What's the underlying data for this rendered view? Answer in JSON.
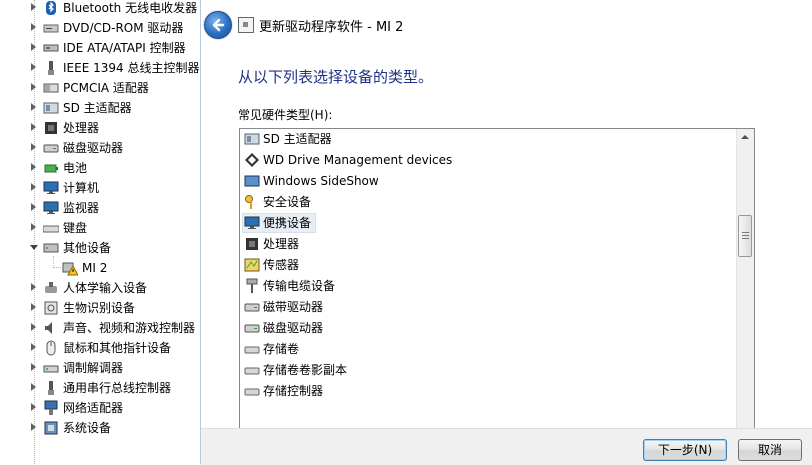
{
  "device_tree": {
    "items": [
      {
        "label": "Bluetooth 无线电收发器",
        "icon": "bluetooth-icon",
        "expanded": false
      },
      {
        "label": "DVD/CD-ROM 驱动器",
        "icon": "dvd-drive-icon",
        "expanded": false
      },
      {
        "label": "IDE ATA/ATAPI 控制器",
        "icon": "ide-controller-icon",
        "expanded": false
      },
      {
        "label": "IEEE 1394 总线主控制器",
        "icon": "ieee1394-icon",
        "expanded": false
      },
      {
        "label": "PCMCIA 适配器",
        "icon": "pcmcia-icon",
        "expanded": false
      },
      {
        "label": "SD 主适配器",
        "icon": "sd-adapter-icon",
        "expanded": false
      },
      {
        "label": "处理器",
        "icon": "processor-icon",
        "expanded": false
      },
      {
        "label": "磁盘驱动器",
        "icon": "disk-drive-icon",
        "expanded": false
      },
      {
        "label": "电池",
        "icon": "battery-icon",
        "expanded": false
      },
      {
        "label": "计算机",
        "icon": "computer-icon",
        "expanded": false
      },
      {
        "label": "监视器",
        "icon": "monitor-icon",
        "expanded": false
      },
      {
        "label": "键盘",
        "icon": "keyboard-icon",
        "expanded": false
      },
      {
        "label": "其他设备",
        "icon": "other-devices-icon",
        "expanded": true
      },
      {
        "label": "MI 2",
        "icon": "warning-device-icon",
        "child": true
      },
      {
        "label": "人体学输入设备",
        "icon": "hid-icon",
        "expanded": false
      },
      {
        "label": "生物识别设备",
        "icon": "biometric-icon",
        "expanded": false
      },
      {
        "label": "声音、视频和游戏控制器",
        "icon": "sound-icon",
        "expanded": false
      },
      {
        "label": "鼠标和其他指针设备",
        "icon": "mouse-icon",
        "expanded": false
      },
      {
        "label": "调制解调器",
        "icon": "modem-icon",
        "expanded": false
      },
      {
        "label": "通用串行总线控制器",
        "icon": "usb-icon",
        "expanded": false
      },
      {
        "label": "网络适配器",
        "icon": "network-adapter-icon",
        "expanded": false
      },
      {
        "label": "系统设备",
        "icon": "system-devices-icon",
        "expanded": false
      }
    ]
  },
  "dialog": {
    "title": "更新驱动程序软件 - MI 2",
    "heading": "从以下列表选择设备的类型。",
    "list_label": "常见硬件类型(H):",
    "hardware_types": [
      {
        "label": "SD 主适配器",
        "icon": "sd-adapter-icon"
      },
      {
        "label": "WD Drive Management devices",
        "icon": "wd-device-icon"
      },
      {
        "label": "Windows SideShow",
        "icon": "sideshow-icon"
      },
      {
        "label": "安全设备",
        "icon": "security-key-icon"
      },
      {
        "label": "便携设备",
        "icon": "portable-device-icon",
        "selected": true
      },
      {
        "label": "处理器",
        "icon": "processor-icon"
      },
      {
        "label": "传感器",
        "icon": "sensor-icon"
      },
      {
        "label": "传输电缆设备",
        "icon": "cable-icon"
      },
      {
        "label": "磁带驱动器",
        "icon": "tape-drive-icon"
      },
      {
        "label": "磁盘驱动器",
        "icon": "disk-drive-icon"
      },
      {
        "label": "存储卷",
        "icon": "volume-icon"
      },
      {
        "label": "存储卷卷影副本",
        "icon": "shadow-copy-icon"
      },
      {
        "label": "存储控制器",
        "icon": "storage-controller-icon"
      }
    ],
    "next_label": "下一步(N)",
    "cancel_label": "取消"
  },
  "colors": {
    "heading": "#1e3287",
    "selection": "#e8eef6",
    "footer": "#f0f0f0"
  }
}
